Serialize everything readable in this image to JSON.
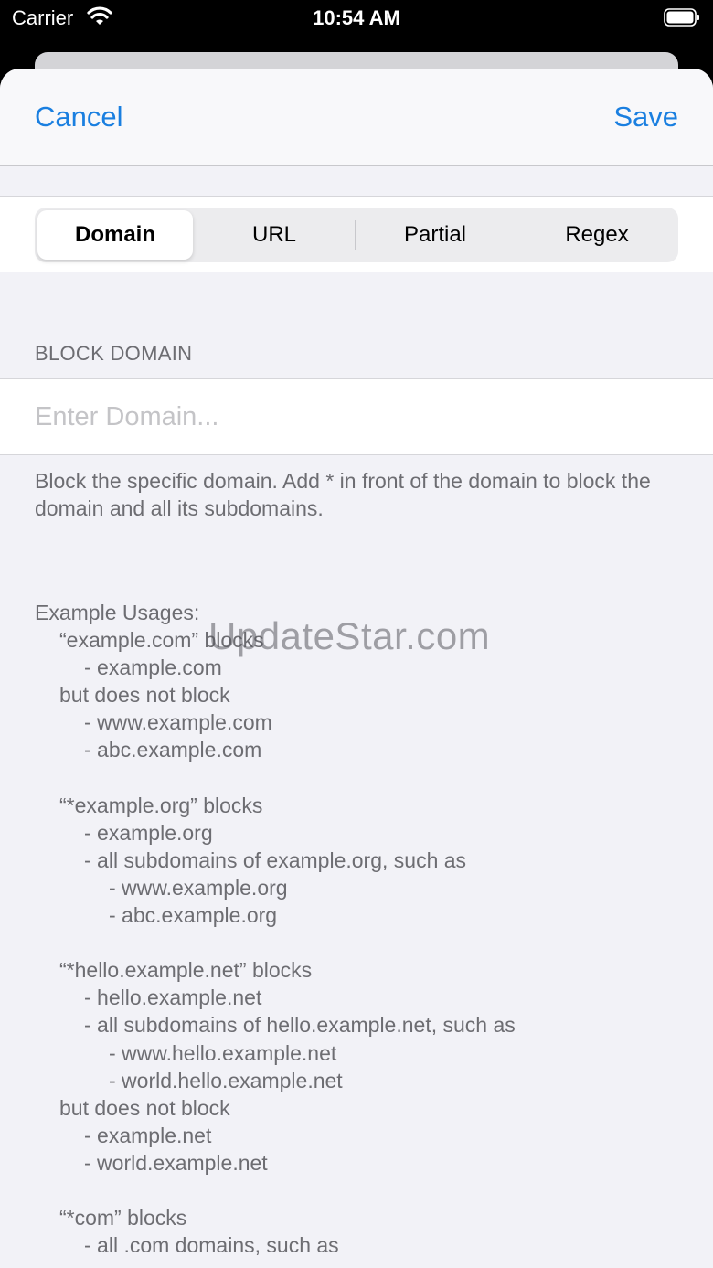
{
  "status_bar": {
    "carrier": "Carrier",
    "time": "10:54 AM",
    "icons": [
      "wifi-icon",
      "battery-icon"
    ]
  },
  "navbar": {
    "cancel_label": "Cancel",
    "save_label": "Save",
    "accent_color": "#1a7fe0"
  },
  "segments": {
    "items": [
      "Domain",
      "URL",
      "Partial",
      "Regex"
    ],
    "selected": "Domain"
  },
  "section": {
    "header": "BLOCK DOMAIN",
    "input_placeholder": "Enter Domain...",
    "input_value": "",
    "description": "Block the specific domain. Add * in front of the domain to block the domain and all its subdomains."
  },
  "examples": {
    "title": "Example Usages:",
    "lines": [
      "“example.com” blocks",
      "- example.com",
      "but does not block",
      "- www.example.com",
      "- abc.example.com",
      "",
      "“*example.org” blocks",
      "- example.org",
      "- all subdomains of example.org, such as",
      "- www.example.org",
      "- abc.example.org",
      "",
      "“*hello.example.net” blocks",
      "- hello.example.net",
      "- all subdomains of hello.example.net, such as",
      "- www.hello.example.net",
      "- world.hello.example.net",
      "but does not block",
      "- example.net",
      "- world.example.net",
      "",
      "“*com” blocks",
      "- all .com domains, such as"
    ]
  },
  "watermark": "UpdateStar.com"
}
